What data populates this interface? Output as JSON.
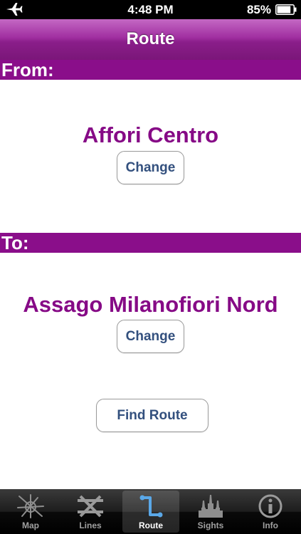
{
  "status_bar": {
    "time": "4:48 PM",
    "battery_percent": "85%",
    "battery_level": 0.85,
    "airplane_icon": "airplane-icon",
    "battery_icon": "battery-icon"
  },
  "nav": {
    "title": "Route"
  },
  "from": {
    "label": "From:",
    "station": "Affori Centro",
    "change_label": "Change"
  },
  "to": {
    "label": "To:",
    "station": "Assago Milanofiori Nord",
    "change_label": "Change"
  },
  "find_route_label": "Find Route",
  "tabs": [
    {
      "label": "Map",
      "icon": "map-icon",
      "selected": false
    },
    {
      "label": "Lines",
      "icon": "lines-icon",
      "selected": false
    },
    {
      "label": "Route",
      "icon": "route-icon",
      "selected": true
    },
    {
      "label": "Sights",
      "icon": "sights-icon",
      "selected": false
    },
    {
      "label": "Info",
      "icon": "info-icon",
      "selected": false
    }
  ],
  "colors": {
    "brand_purple": "#8a0e8a",
    "station_text": "#860a86",
    "button_text": "#33507e",
    "route_icon_blue": "#5aa8e8"
  }
}
